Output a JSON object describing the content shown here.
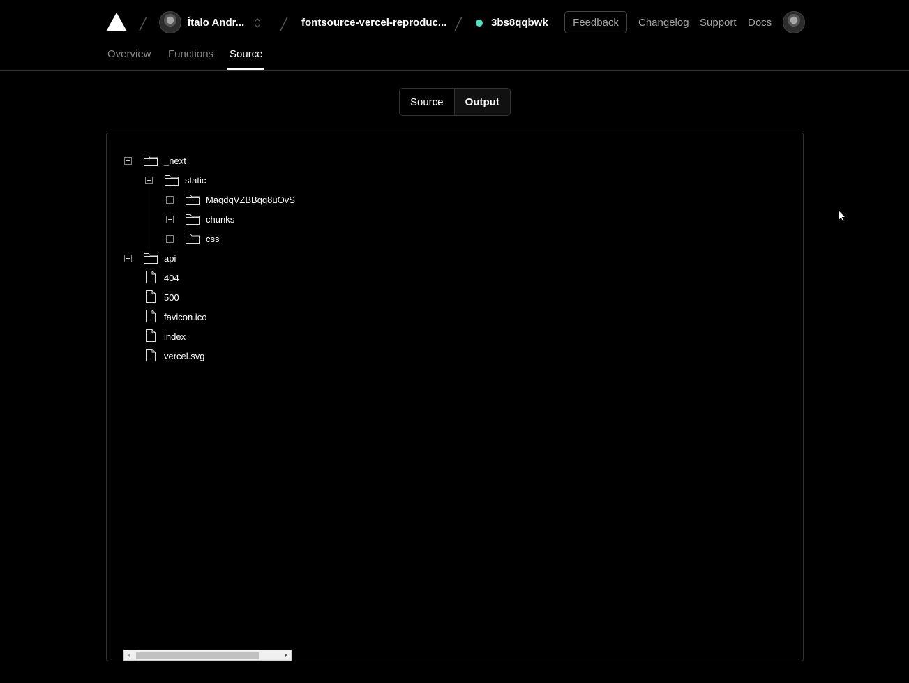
{
  "header": {
    "team_name": "Ítalo Andr...",
    "project_name": "fontsource-vercel-reproduc...",
    "deployment_id": "3bs8qqbwk",
    "status_color": "#50e3c2",
    "feedback_label": "Feedback",
    "links": [
      "Changelog",
      "Support",
      "Docs"
    ]
  },
  "tabs": [
    {
      "label": "Overview",
      "active": false
    },
    {
      "label": "Functions",
      "active": false
    },
    {
      "label": "Source",
      "active": true
    }
  ],
  "view_toggle": {
    "source_label": "Source",
    "output_label": "Output",
    "selected": "Output"
  },
  "tree": [
    {
      "name": "_next",
      "type": "folder",
      "expanded": true
    },
    {
      "name": "static",
      "type": "folder",
      "expanded": true
    },
    {
      "name": "MaqdqVZBBqq8uOvS",
      "type": "folder",
      "expanded": false
    },
    {
      "name": "chunks",
      "type": "folder",
      "expanded": false
    },
    {
      "name": "css",
      "type": "folder",
      "expanded": false
    },
    {
      "name": "api",
      "type": "folder",
      "expanded": false
    },
    {
      "name": "404",
      "type": "file"
    },
    {
      "name": "500",
      "type": "file"
    },
    {
      "name": "favicon.ico",
      "type": "file"
    },
    {
      "name": "index",
      "type": "file"
    },
    {
      "name": "vercel.svg",
      "type": "file"
    }
  ]
}
